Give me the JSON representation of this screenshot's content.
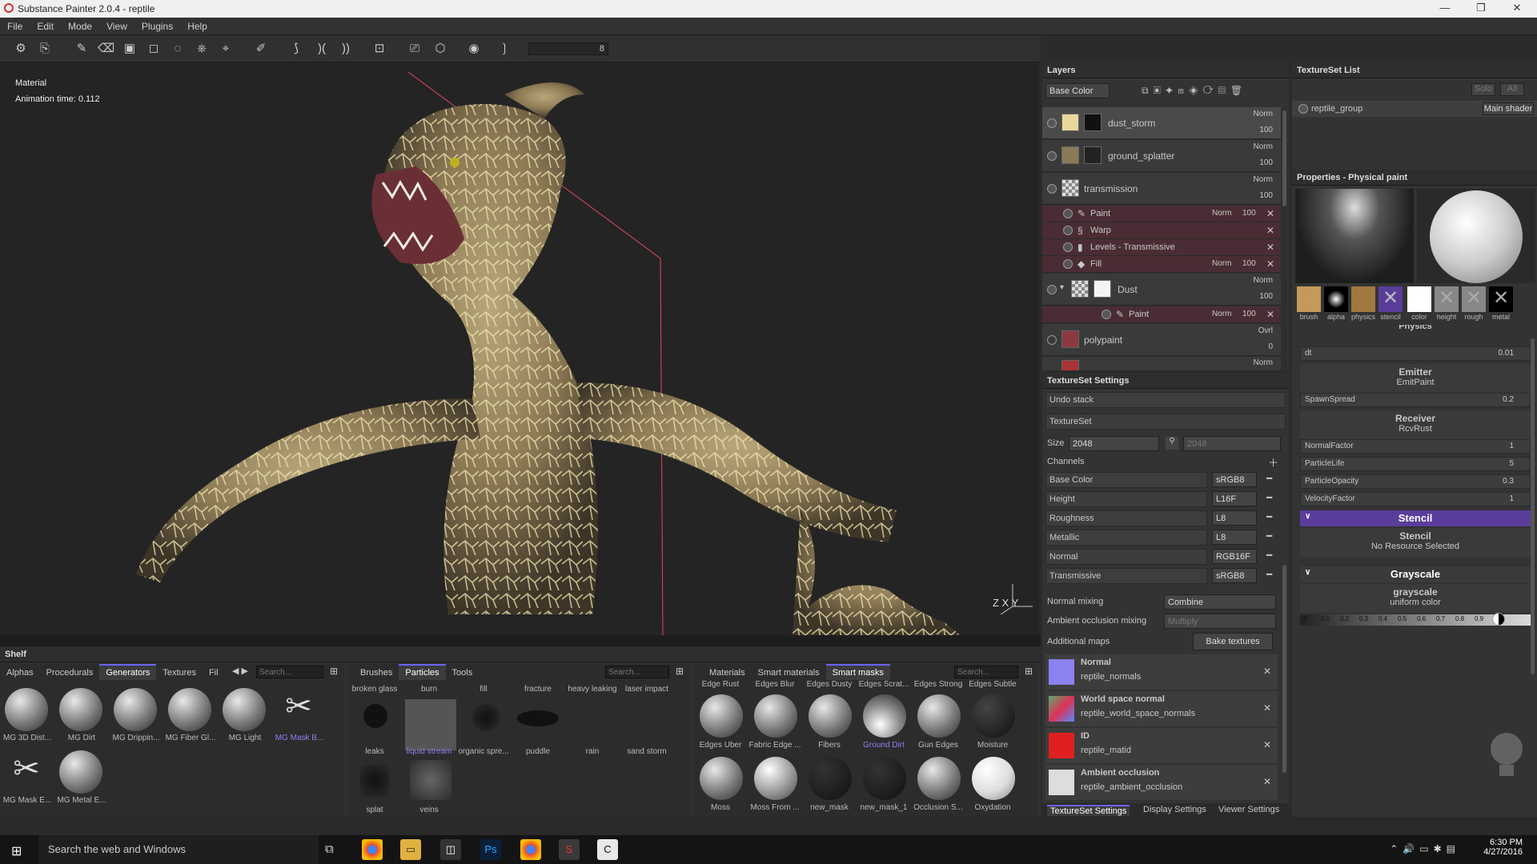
{
  "window": {
    "title": "Substance Painter 2.0.4 - reptile"
  },
  "menu": [
    "File",
    "Edit",
    "Mode",
    "View",
    "Plugins",
    "Help"
  ],
  "toolbar": {
    "value": "8"
  },
  "viewport": {
    "mode": "Material",
    "anim": "Animation time: 0.112",
    "axes": "Z X Y"
  },
  "layers": {
    "title": "Layers",
    "channel": "Base Color",
    "rows": [
      {
        "name": "dust_storm",
        "blend": "Norm",
        "opacity": "100"
      },
      {
        "name": "ground_splatter",
        "blend": "Norm",
        "opacity": "100"
      },
      {
        "name": "transmission",
        "blend": "Norm",
        "opacity": "100"
      },
      {
        "name": "Dust",
        "blend": "Norm",
        "opacity": "100"
      },
      {
        "name": "polypaint",
        "blend": "Ovrl",
        "opacity": "0"
      },
      {
        "name": "",
        "blend": "Norm",
        "opacity": ""
      }
    ],
    "subs": [
      {
        "name": "Paint",
        "blend": "Norm",
        "opacity": "100"
      },
      {
        "name": "Warp",
        "blend": "",
        "opacity": ""
      },
      {
        "name": "Levels - Transmissive",
        "blend": "",
        "opacity": ""
      },
      {
        "name": "Fill",
        "blend": "Norm",
        "opacity": "100"
      }
    ],
    "dust_sub": {
      "name": "Paint",
      "blend": "Norm",
      "opacity": "100"
    }
  },
  "tss": {
    "title": "TextureSet Settings",
    "undo": "Undo stack",
    "textureset": "TextureSet",
    "size_label": "Size",
    "size": "2048",
    "size2": "2048",
    "channels_label": "Channels",
    "channels": [
      {
        "name": "Base Color",
        "format": "sRGB8"
      },
      {
        "name": "Height",
        "format": "L16F"
      },
      {
        "name": "Roughness",
        "format": "L8"
      },
      {
        "name": "Metallic",
        "format": "L8"
      },
      {
        "name": "Normal",
        "format": "RGB16F"
      },
      {
        "name": "Transmissive",
        "format": "sRGB8"
      }
    ],
    "normal_mixing_label": "Normal mixing",
    "normal_mixing": "Combine",
    "ao_mixing_label": "Ambient occlusion mixing",
    "ao_mixing": "Multiply",
    "additional_label": "Additional maps",
    "bake": "Bake textures",
    "maps": [
      {
        "name": "Normal",
        "file": "reptile_normals",
        "color": "#8a82f0"
      },
      {
        "name": "World space normal",
        "file": "reptile_world_space_normals",
        "color": "#5aa96a"
      },
      {
        "name": "ID",
        "file": "reptile_matid",
        "color": "#e02020"
      },
      {
        "name": "Ambient occlusion",
        "file": "reptile_ambient_occlusion",
        "color": "#dddddd"
      }
    ],
    "bottom_tabs": [
      "TextureSet Settings",
      "Display Settings",
      "Viewer Settings"
    ]
  },
  "tsl": {
    "title": "TextureSet List",
    "solo": "Solo",
    "all": "All",
    "group": "reptile_group",
    "shader": "Main shader"
  },
  "props": {
    "title": "Properties - Physical paint",
    "slots": [
      "brush",
      "alpha",
      "physics",
      "stencil",
      "color",
      "height",
      "rough",
      "metal"
    ],
    "physics_header": "Physics",
    "dt_label": "dt",
    "dt": "0.01",
    "emitter": "Emitter",
    "emitter_sub": "EmitPaint",
    "spawn_label": "SpawnSpread",
    "spawn": "0.2",
    "receiver": "Receiver",
    "receiver_sub": "RcvRust",
    "params": [
      {
        "name": "NormalFactor",
        "val": "1"
      },
      {
        "name": "ParticleLife",
        "val": "5"
      },
      {
        "name": "ParticleOpacity",
        "val": "0.3"
      },
      {
        "name": "VelocityFactor",
        "val": "1"
      }
    ],
    "stencil_header": "Stencil",
    "stencil": "Stencil",
    "stencil_sub": "No Resource Selected",
    "gray_header": "Grayscale",
    "gray": "grayscale",
    "gray_sub": "uniform color",
    "ticks": [
      "0",
      "0.1",
      "0.2",
      "0.3",
      "0.4",
      "0.5",
      "0.6",
      "0.7",
      "0.8",
      "0.9",
      "1"
    ]
  },
  "shelf": {
    "title": "Shelf",
    "tabs": [
      "Alphas",
      "Procedurals",
      "Generators",
      "Textures",
      "Fil"
    ],
    "search": "Search...",
    "gen": [
      "MG 3D Dist...",
      "MG Dirt",
      "MG Drippin...",
      "MG Fiber Gl...",
      "MG Light",
      "MG Mask B...",
      "MG Mask E...",
      "MG Metal E..."
    ],
    "ptabs": [
      "Brushes",
      "Particles",
      "Tools"
    ],
    "particles_top": [
      "broken glass",
      "burn",
      "fill",
      "fracture",
      "heavy leaking",
      "laser impact"
    ],
    "particles": [
      "leaks",
      "liquid stream",
      "organic spre...",
      "puddle",
      "rain",
      "sand storm",
      "splat",
      "veins"
    ],
    "mtabs": [
      "Materials",
      "Smart materials",
      "Smart masks"
    ],
    "masks_top": [
      "Edge Rust",
      "Edges Blur",
      "Edges Dusty",
      "Edges Scrat...",
      "Edges Strong",
      "Edges Subtle"
    ],
    "masks": [
      "Edges Uber",
      "Fabric Edge ...",
      "Fibers",
      "Ground Dirt",
      "Gun Edges",
      "Moisture",
      "Moss",
      "Moss From ...",
      "new_mask",
      "new_mask_1",
      "Occlusion S...",
      "Oxydation"
    ]
  },
  "taskbar": {
    "search": "Search the web and Windows",
    "time": "6:30 PM",
    "date": "4/27/2016"
  },
  "colors": {
    "accent": "#6c63ff",
    "layer_sub": "#4a2d34",
    "stencil_bar": "#5a3d9a"
  }
}
